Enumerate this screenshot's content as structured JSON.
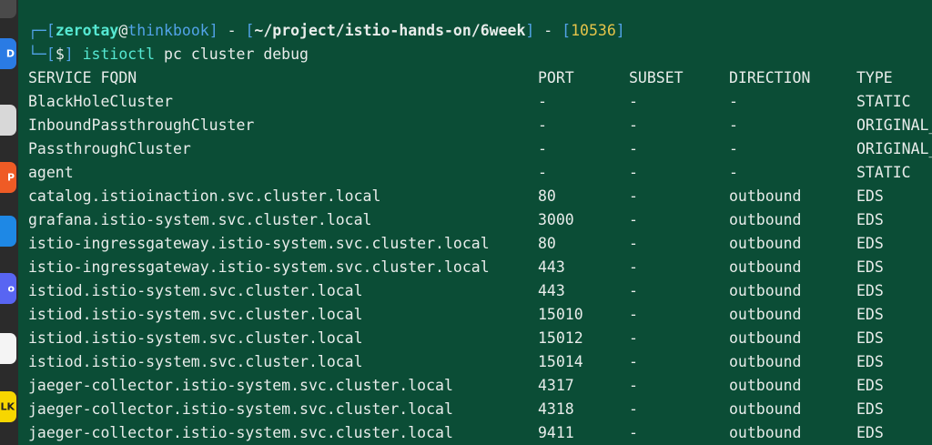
{
  "dock": {
    "icons": [
      {
        "name": "terminal-app-icon",
        "color": "#4a4a4a",
        "glyph": ""
      },
      {
        "name": "app-icon-blue",
        "color": "#2a7be4",
        "glyph": "D"
      },
      {
        "name": "files-app-icon",
        "color": "#d8d8d8",
        "glyph": ""
      },
      {
        "name": "postman-app-icon",
        "color": "#ef5b25",
        "glyph": "P"
      },
      {
        "name": "vscode-app-icon",
        "color": "#1e88e5",
        "glyph": ""
      },
      {
        "name": "discord-app-icon",
        "color": "#5865f2",
        "glyph": "o"
      },
      {
        "name": "slack-app-icon",
        "color": "#f4f4f4",
        "glyph": ""
      },
      {
        "name": "kakaotalk-app-icon",
        "color": "#f7d600",
        "glyph": "LK"
      }
    ]
  },
  "prompt": {
    "user": "zerotay",
    "at": "@",
    "host": "thinkbook",
    "separator": " - ",
    "path": "~/project/istio-hands-on/6week",
    "pid": "10536",
    "dollar": "$",
    "command": "istioctl",
    "args": " pc cluster debug"
  },
  "table": {
    "headers": {
      "fqdn": "SERVICE FQDN",
      "port": "PORT",
      "subset": "SUBSET",
      "direction": "DIRECTION",
      "type": "TYPE"
    },
    "rows": [
      {
        "fqdn": "BlackHoleCluster",
        "port": "-",
        "subset": "-",
        "direction": "-",
        "type": "STATIC"
      },
      {
        "fqdn": "InboundPassthroughCluster",
        "port": "-",
        "subset": "-",
        "direction": "-",
        "type": "ORIGINAL_"
      },
      {
        "fqdn": "PassthroughCluster",
        "port": "-",
        "subset": "-",
        "direction": "-",
        "type": "ORIGINAL_"
      },
      {
        "fqdn": "agent",
        "port": "-",
        "subset": "-",
        "direction": "-",
        "type": "STATIC"
      },
      {
        "fqdn": "catalog.istioinaction.svc.cluster.local",
        "port": "80",
        "subset": "-",
        "direction": "outbound",
        "type": "EDS"
      },
      {
        "fqdn": "grafana.istio-system.svc.cluster.local",
        "port": "3000",
        "subset": "-",
        "direction": "outbound",
        "type": "EDS"
      },
      {
        "fqdn": "istio-ingressgateway.istio-system.svc.cluster.local",
        "port": "80",
        "subset": "-",
        "direction": "outbound",
        "type": "EDS"
      },
      {
        "fqdn": "istio-ingressgateway.istio-system.svc.cluster.local",
        "port": "443",
        "subset": "-",
        "direction": "outbound",
        "type": "EDS"
      },
      {
        "fqdn": "istiod.istio-system.svc.cluster.local",
        "port": "443",
        "subset": "-",
        "direction": "outbound",
        "type": "EDS"
      },
      {
        "fqdn": "istiod.istio-system.svc.cluster.local",
        "port": "15010",
        "subset": "-",
        "direction": "outbound",
        "type": "EDS"
      },
      {
        "fqdn": "istiod.istio-system.svc.cluster.local",
        "port": "15012",
        "subset": "-",
        "direction": "outbound",
        "type": "EDS"
      },
      {
        "fqdn": "istiod.istio-system.svc.cluster.local",
        "port": "15014",
        "subset": "-",
        "direction": "outbound",
        "type": "EDS"
      },
      {
        "fqdn": "jaeger-collector.istio-system.svc.cluster.local",
        "port": "4317",
        "subset": "-",
        "direction": "outbound",
        "type": "EDS"
      },
      {
        "fqdn": "jaeger-collector.istio-system.svc.cluster.local",
        "port": "4318",
        "subset": "-",
        "direction": "outbound",
        "type": "EDS"
      },
      {
        "fqdn": "jaeger-collector.istio-system.svc.cluster.local",
        "port": "9411",
        "subset": "-",
        "direction": "outbound",
        "type": "EDS"
      }
    ]
  }
}
